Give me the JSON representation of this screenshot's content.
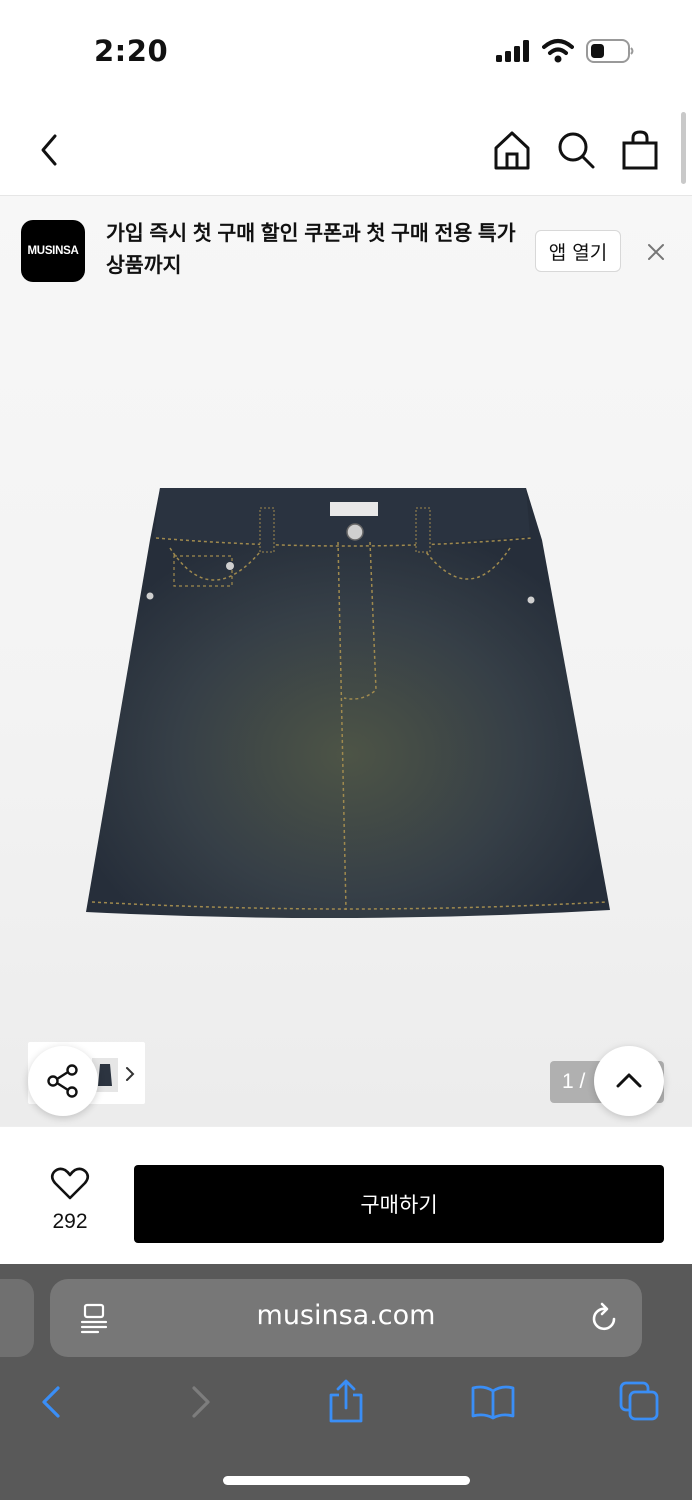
{
  "status_bar": {
    "time": "2:20"
  },
  "nav": {
    "icons": [
      "back-icon",
      "home-icon",
      "search-icon",
      "shopping-bag-icon"
    ]
  },
  "promo": {
    "logo_text": "MUSINSA",
    "message": "가입 즉시 첫 구매 할인 쿠폰과 첫 구매 전용 특가 상품까지",
    "open_app_label": "앱 열기"
  },
  "product": {
    "image_counter": "1 /"
  },
  "purchase": {
    "like_count": "292",
    "buy_label": "구매하기"
  },
  "browser": {
    "url": "musinsa.com"
  },
  "colors": {
    "accent_blue": "#3a8ef6",
    "buy_button": "#000000",
    "safari_bg": "#595959"
  }
}
